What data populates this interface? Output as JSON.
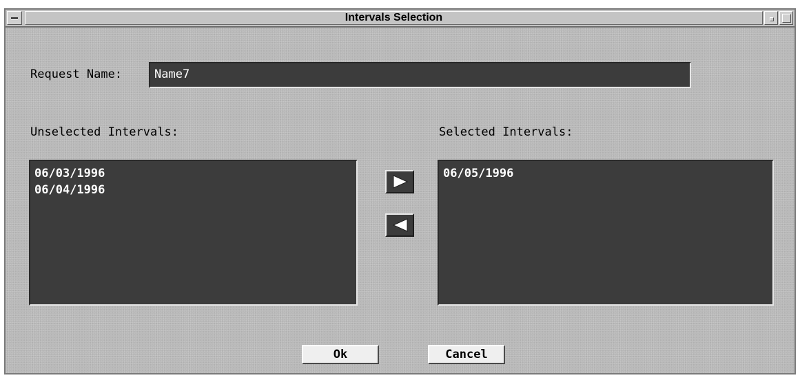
{
  "window": {
    "title": "Intervals Selection"
  },
  "request": {
    "label": "Request Name:",
    "value": "Name7"
  },
  "unselected": {
    "label": "Unselected Intervals:",
    "items": [
      "06/03/1996",
      "06/04/1996"
    ]
  },
  "selected": {
    "label": "Selected Intervals:",
    "items": [
      "06/05/1996"
    ]
  },
  "buttons": {
    "ok_label": "Ok",
    "cancel_label": "Cancel"
  },
  "icons": {
    "move_right": "triangle-right-icon",
    "move_left": "triangle-left-icon",
    "window_menu": "window-menu-icon",
    "minimize": "minimize-icon",
    "maximize": "maximize-icon"
  },
  "colors": {
    "dialog_bg": "#b8b8b8",
    "field_bg": "#3c3c3c",
    "field_text": "#ffffff",
    "button_bg": "#efefef"
  }
}
